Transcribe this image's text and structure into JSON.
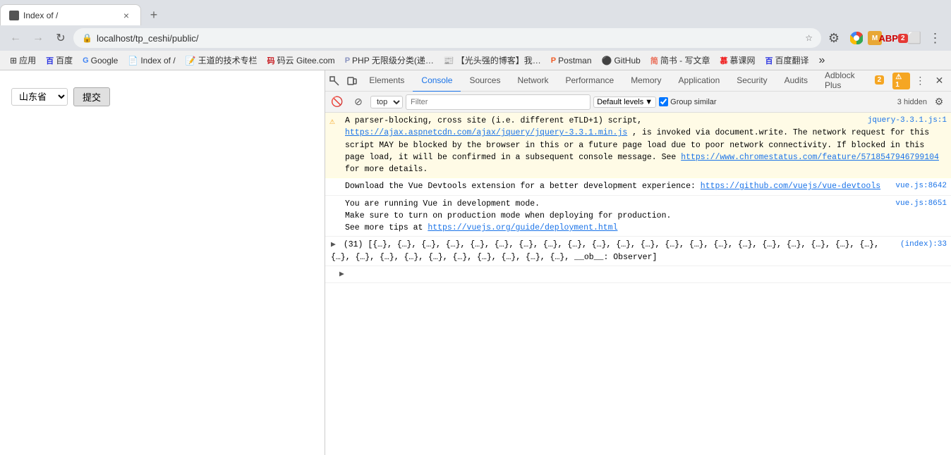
{
  "browser": {
    "tab_title": "Index of /",
    "address": "localhost/tp_ceshi/public/",
    "address_protocol": "localhost"
  },
  "bookmarks": [
    {
      "label": "应用",
      "icon": "grid"
    },
    {
      "label": "百度",
      "icon": "baidu"
    },
    {
      "label": "Google",
      "icon": "google"
    },
    {
      "label": "Index of /",
      "icon": "doc"
    },
    {
      "label": "王道的技术专栏",
      "icon": "doc"
    },
    {
      "label": "码云 Gitee.com",
      "icon": "gitee"
    },
    {
      "label": "PHP 无限级分类(递…",
      "icon": "php"
    },
    {
      "label": "【光头强的博客】我…",
      "icon": "blog"
    },
    {
      "label": "Postman",
      "icon": "postman"
    },
    {
      "label": "GitHub",
      "icon": "github"
    },
    {
      "label": "简书 - 写文章",
      "icon": "jianshu"
    },
    {
      "label": "慕课网",
      "icon": "mooc"
    },
    {
      "label": "百度翻译",
      "icon": "translate"
    }
  ],
  "page": {
    "province_label": "山东省",
    "submit_label": "提交"
  },
  "devtools": {
    "tabs": [
      "Elements",
      "Console",
      "Sources",
      "Network",
      "Performance",
      "Memory",
      "Application",
      "Security",
      "Audits",
      "Adblock Plus"
    ],
    "active_tab": "Console",
    "adblock_badge": "2",
    "warn_badge": "1",
    "console": {
      "context": "top",
      "filter_placeholder": "Filter",
      "levels_label": "Default levels",
      "group_similar_label": "Group similar",
      "hidden_count": "3 hidden",
      "messages": [
        {
          "type": "warning",
          "text": "A parser-blocking, cross site (i.e. different eTLD+1) script, https://ajax.aspnetcdn.com/ajax/jquery/jquery-3.3.1.min.js, is invoked via document.write. The network request for this script MAY be blocked by the browser in this or a future page load due to poor network connectivity. If blocked in this page load, it will be confirmed in a subsequent console message. See https://www.chromestatus.com/feature/5718547946799104 for more details.",
          "link1": "https://ajax.aspnetcdn.com/ajax/jquery/jquery-3.3.1.min.js",
          "link1_short": "jquery-3.3.1.js:1",
          "link2": "https://www.chromestatus.com/feature/5718547946799104"
        },
        {
          "type": "info",
          "text": "Download the Vue Devtools extension for a better development experience:",
          "link": "https://github.com/vuejs/vue-devtools",
          "source": "vue.js:8642"
        },
        {
          "type": "info",
          "text": "You are running Vue in development mode.\nMake sure to turn on production mode when deploying for production.\nSee more tips at https://vuejs.org/guide/deployment.html",
          "link": "https://vuejs.org/guide/deployment.html",
          "source": "vue.js:8651"
        },
        {
          "type": "data",
          "source": "(index):33",
          "text": "(31) [{…}, {…}, {…}, {…}, {…}, {…}, {…}, {…}, {…}, {…}, {…}, {…}, {…}, {…}, {…}, {…}, {…}, {…}, {…}, {…}, {…}, {…}, {…}, {…}, {…}, {…}, {…}, {…}, {…}, {…}, {…}, __ob__: Observer]"
        }
      ]
    }
  }
}
